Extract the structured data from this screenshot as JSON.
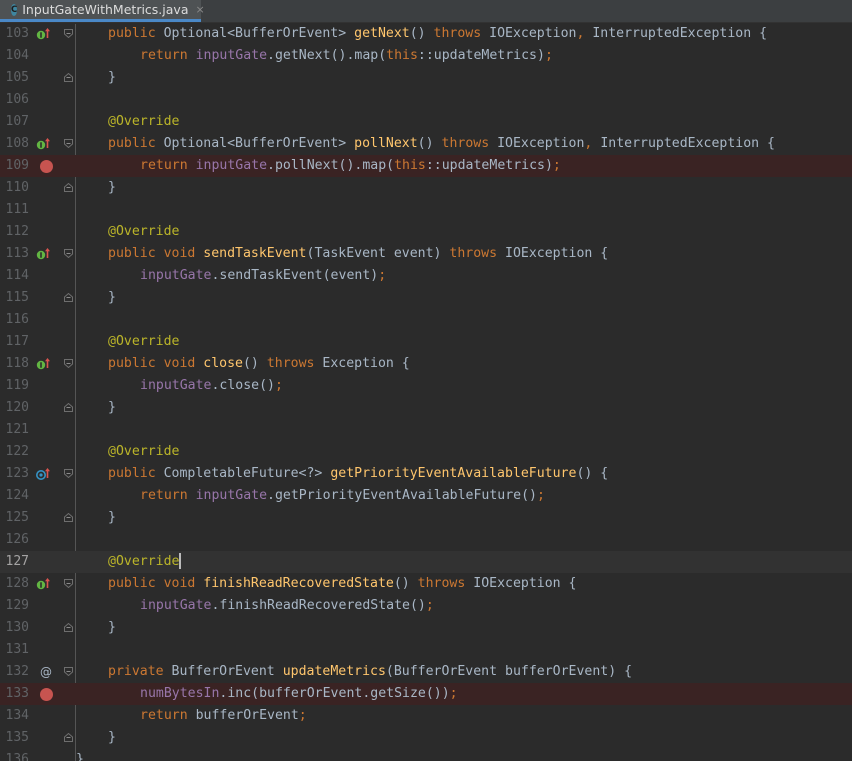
{
  "tab": {
    "icon_letter": "C",
    "filename": "InputGateWithMetrics.java",
    "close": "×"
  },
  "colors": {
    "keyword": "#cc7832",
    "method": "#ffc66d",
    "field": "#9876aa",
    "annotation": "#bbb529",
    "text": "#a9b7c6",
    "breakpoint": "#c75450"
  },
  "lines": [
    {
      "n": "103",
      "marker": "implements-up",
      "fold": "start",
      "tokens": [
        [
          "kw",
          "public "
        ],
        [
          "",
          "Optional<BufferOrEvent> "
        ],
        [
          "fn",
          "getNext"
        ],
        [
          "",
          "() "
        ],
        [
          "kw",
          "throws "
        ],
        [
          "",
          "IOException"
        ],
        [
          "kw",
          ", "
        ],
        [
          "",
          "InterruptedException {"
        ]
      ],
      "indent": 1
    },
    {
      "n": "104",
      "marker": "",
      "fold": "",
      "tokens": [
        [
          "kw",
          "return "
        ],
        [
          "fld",
          "inputGate"
        ],
        [
          "",
          ".getNext().map("
        ],
        [
          "kw",
          "this"
        ],
        [
          "",
          "::updateMetrics)"
        ],
        [
          "kw",
          ";"
        ]
      ],
      "indent": 2
    },
    {
      "n": "105",
      "marker": "",
      "fold": "end",
      "tokens": [
        [
          "",
          "}"
        ]
      ],
      "indent": 1
    },
    {
      "n": "106",
      "marker": "",
      "fold": "",
      "tokens": [],
      "indent": 1
    },
    {
      "n": "107",
      "marker": "",
      "fold": "",
      "tokens": [
        [
          "ann",
          "@Override"
        ]
      ],
      "indent": 1
    },
    {
      "n": "108",
      "marker": "implements-up",
      "fold": "start",
      "tokens": [
        [
          "kw",
          "public "
        ],
        [
          "",
          "Optional<BufferOrEvent> "
        ],
        [
          "fn",
          "pollNext"
        ],
        [
          "",
          "() "
        ],
        [
          "kw",
          "throws "
        ],
        [
          "",
          "IOException"
        ],
        [
          "kw",
          ", "
        ],
        [
          "",
          "InterruptedException {"
        ]
      ],
      "indent": 1
    },
    {
      "n": "109",
      "marker": "breakpoint",
      "fold": "",
      "tokens": [
        [
          "kw",
          "return "
        ],
        [
          "fld",
          "inputGate"
        ],
        [
          "",
          ".pollNext().map("
        ],
        [
          "kw",
          "this"
        ],
        [
          "",
          "::updateMetrics)"
        ],
        [
          "kw",
          ";"
        ]
      ],
      "indent": 2
    },
    {
      "n": "110",
      "marker": "",
      "fold": "end",
      "tokens": [
        [
          "",
          "}"
        ]
      ],
      "indent": 1
    },
    {
      "n": "111",
      "marker": "",
      "fold": "",
      "tokens": [],
      "indent": 1
    },
    {
      "n": "112",
      "marker": "",
      "fold": "",
      "tokens": [
        [
          "ann",
          "@Override"
        ]
      ],
      "indent": 1
    },
    {
      "n": "113",
      "marker": "implements-up",
      "fold": "start",
      "tokens": [
        [
          "kw",
          "public void "
        ],
        [
          "fn",
          "sendTaskEvent"
        ],
        [
          "",
          "(TaskEvent event) "
        ],
        [
          "kw",
          "throws "
        ],
        [
          "",
          "IOException {"
        ]
      ],
      "indent": 1
    },
    {
      "n": "114",
      "marker": "",
      "fold": "",
      "tokens": [
        [
          "fld",
          "inputGate"
        ],
        [
          "",
          ".sendTaskEvent(event)"
        ],
        [
          "kw",
          ";"
        ]
      ],
      "indent": 2
    },
    {
      "n": "115",
      "marker": "",
      "fold": "end",
      "tokens": [
        [
          "",
          "}"
        ]
      ],
      "indent": 1
    },
    {
      "n": "116",
      "marker": "",
      "fold": "",
      "tokens": [],
      "indent": 1
    },
    {
      "n": "117",
      "marker": "",
      "fold": "",
      "tokens": [
        [
          "ann",
          "@Override"
        ]
      ],
      "indent": 1
    },
    {
      "n": "118",
      "marker": "implements-up",
      "fold": "start",
      "tokens": [
        [
          "kw",
          "public void "
        ],
        [
          "fn",
          "close"
        ],
        [
          "",
          "() "
        ],
        [
          "kw",
          "throws "
        ],
        [
          "",
          "Exception {"
        ]
      ],
      "indent": 1
    },
    {
      "n": "119",
      "marker": "",
      "fold": "",
      "tokens": [
        [
          "fld",
          "inputGate"
        ],
        [
          "",
          ".close()"
        ],
        [
          "kw",
          ";"
        ]
      ],
      "indent": 2
    },
    {
      "n": "120",
      "marker": "",
      "fold": "end",
      "tokens": [
        [
          "",
          "}"
        ]
      ],
      "indent": 1
    },
    {
      "n": "121",
      "marker": "",
      "fold": "",
      "tokens": [],
      "indent": 1
    },
    {
      "n": "122",
      "marker": "",
      "fold": "",
      "tokens": [
        [
          "ann",
          "@Override"
        ]
      ],
      "indent": 1
    },
    {
      "n": "123",
      "marker": "overrides-up",
      "fold": "start",
      "tokens": [
        [
          "kw",
          "public "
        ],
        [
          "",
          "CompletableFuture<?> "
        ],
        [
          "fn",
          "getPriorityEventAvailableFuture"
        ],
        [
          "",
          "() {"
        ]
      ],
      "indent": 1
    },
    {
      "n": "124",
      "marker": "",
      "fold": "",
      "tokens": [
        [
          "kw",
          "return "
        ],
        [
          "fld",
          "inputGate"
        ],
        [
          "",
          ".getPriorityEventAvailableFuture()"
        ],
        [
          "kw",
          ";"
        ]
      ],
      "indent": 2
    },
    {
      "n": "125",
      "marker": "",
      "fold": "end",
      "tokens": [
        [
          "",
          "}"
        ]
      ],
      "indent": 1
    },
    {
      "n": "126",
      "marker": "",
      "fold": "",
      "tokens": [],
      "indent": 1
    },
    {
      "n": "127",
      "marker": "",
      "fold": "",
      "caret": true,
      "tokens": [
        [
          "ann",
          "@Override"
        ]
      ],
      "indent": 1
    },
    {
      "n": "128",
      "marker": "implements-up",
      "fold": "start",
      "tokens": [
        [
          "kw",
          "public void "
        ],
        [
          "fn",
          "finishReadRecoveredState"
        ],
        [
          "",
          "() "
        ],
        [
          "kw",
          "throws "
        ],
        [
          "",
          "IOException {"
        ]
      ],
      "indent": 1
    },
    {
      "n": "129",
      "marker": "",
      "fold": "",
      "tokens": [
        [
          "fld",
          "inputGate"
        ],
        [
          "",
          ".finishReadRecoveredState()"
        ],
        [
          "kw",
          ";"
        ]
      ],
      "indent": 2
    },
    {
      "n": "130",
      "marker": "",
      "fold": "end",
      "tokens": [
        [
          "",
          "}"
        ]
      ],
      "indent": 1
    },
    {
      "n": "131",
      "marker": "",
      "fold": "",
      "tokens": [],
      "indent": 1
    },
    {
      "n": "132",
      "marker": "at",
      "fold": "start",
      "tokens": [
        [
          "kw",
          "private "
        ],
        [
          "",
          "BufferOrEvent "
        ],
        [
          "fn",
          "updateMetrics"
        ],
        [
          "",
          "(BufferOrEvent bufferOrEvent) {"
        ]
      ],
      "indent": 1
    },
    {
      "n": "133",
      "marker": "breakpoint",
      "fold": "",
      "tokens": [
        [
          "fld",
          "numBytesIn"
        ],
        [
          "",
          ".inc(bufferOrEvent.getSize())"
        ],
        [
          "kw",
          ";"
        ]
      ],
      "indent": 2
    },
    {
      "n": "134",
      "marker": "",
      "fold": "",
      "tokens": [
        [
          "kw",
          "return "
        ],
        [
          "",
          "bufferOrEvent"
        ],
        [
          "kw",
          ";"
        ]
      ],
      "indent": 2
    },
    {
      "n": "135",
      "marker": "",
      "fold": "end",
      "tokens": [
        [
          "",
          "}"
        ]
      ],
      "indent": 1
    },
    {
      "n": "136",
      "marker": "",
      "fold": "",
      "tokens": [
        [
          "",
          "}"
        ]
      ],
      "indent": 0
    }
  ]
}
